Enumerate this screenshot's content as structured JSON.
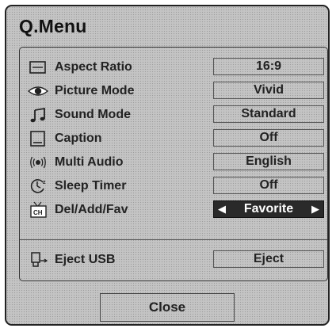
{
  "menu": {
    "title": "Q.Menu",
    "items": [
      {
        "label": "Aspect Ratio",
        "value": "16:9",
        "icon": "aspect-ratio-icon"
      },
      {
        "label": "Picture Mode",
        "value": "Vivid",
        "icon": "eye-icon"
      },
      {
        "label": "Sound Mode",
        "value": "Standard",
        "icon": "music-note-icon"
      },
      {
        "label": "Caption",
        "value": "Off",
        "icon": "caption-icon"
      },
      {
        "label": "Multi Audio",
        "value": "English",
        "icon": "audio-waves-icon"
      },
      {
        "label": "Sleep Timer",
        "value": "Off",
        "icon": "clock-icon"
      },
      {
        "label": "Del/Add/Fav",
        "value": "Favorite",
        "icon": "channel-icon",
        "selected": true
      },
      {
        "label": "Eject USB",
        "value": "Eject",
        "icon": "usb-icon"
      }
    ],
    "close_label": "Close"
  },
  "arrows": {
    "left": "◀",
    "right": "▶"
  },
  "icon_text": {
    "ch": "CH"
  }
}
